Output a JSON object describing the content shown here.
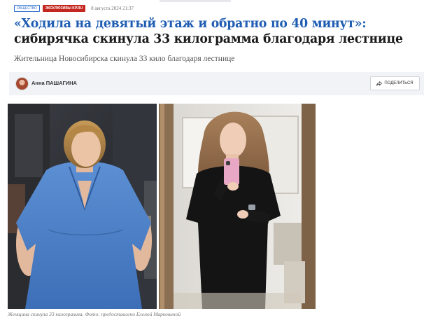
{
  "article": {
    "category_tag": "Общество",
    "exclusive_tag": "Эксклюзивы KP.RU",
    "date": "8 августа 2024 21:37",
    "headline_part1": "«Ходила на девятый этаж и обратно по 40 минут»:",
    "headline_part2": "сибирячка скинула 33 килограмма благодаря лестнице",
    "subtitle": "Жительница Новосибирска скинула 33 кило благодаря лестнице",
    "author_name": "Анна ПАШАГИНА",
    "share_label": "Поделиться",
    "photo_caption": "Женщина скинула 33 килограмма. Фото: предоставлено Еленой Марковиной"
  },
  "colors": {
    "headline_accent": "#1f5db3",
    "exclusive_tag_bg": "#c4271f",
    "author_bar_bg": "#f1f3f6"
  },
  "icons": {
    "share": "share-arrow-icon",
    "avatar": "author-avatar"
  }
}
